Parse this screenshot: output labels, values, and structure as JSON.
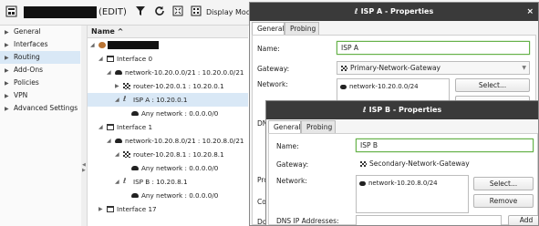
{
  "toolbar": {
    "edit_label": "(EDIT)",
    "display_label": "Display Mode"
  },
  "sidebar": {
    "items": [
      {
        "label": "General",
        "active": false
      },
      {
        "label": "Interfaces",
        "active": false
      },
      {
        "label": "Routing",
        "active": true
      },
      {
        "label": "Add-Ons",
        "active": false
      },
      {
        "label": "Policies",
        "active": false
      },
      {
        "label": "VPN",
        "active": false
      },
      {
        "label": "Advanced Settings",
        "active": false
      }
    ]
  },
  "tree": {
    "header": "Name ^",
    "rows": [
      {
        "label": "",
        "icon": "firewall-icon",
        "indent": 0
      },
      {
        "label": "Interface 0",
        "icon": "interface-icon",
        "indent": 1
      },
      {
        "label": "network-10.20.0.0/21 : 10.20.0.0/21",
        "icon": "network-icon",
        "indent": 2
      },
      {
        "label": "router-10.20.0.1 : 10.20.0.1",
        "icon": "router-icon",
        "indent": 3
      },
      {
        "label": "ISP A : 10.20.0.1",
        "icon": "isp-icon",
        "indent": 3,
        "selected": true
      },
      {
        "label": "Any network : 0.0.0.0/0",
        "icon": "network-icon",
        "indent": 4
      },
      {
        "label": "Interface 1",
        "icon": "interface-icon",
        "indent": 1
      },
      {
        "label": "network-10.20.8.0/21 : 10.20.8.0/21",
        "icon": "network-icon",
        "indent": 2
      },
      {
        "label": "router-10.20.8.1 : 10.20.8.1",
        "icon": "router-icon",
        "indent": 3
      },
      {
        "label": "Any network : 0.0.0.0/0",
        "icon": "network-icon",
        "indent": 4
      },
      {
        "label": "ISP B : 10.20.8.1",
        "icon": "isp-icon",
        "indent": 3
      },
      {
        "label": "Any network : 0.0.0.0/0",
        "icon": "network-icon",
        "indent": 4
      },
      {
        "label": "Interface 17",
        "icon": "interface-icon",
        "indent": 1
      }
    ]
  },
  "dialog_a": {
    "title": "ISP A - Properties",
    "close": "×",
    "tabs": [
      "General",
      "Probing"
    ],
    "name_label": "Name:",
    "name_value": "ISP A",
    "gateway_label": "Gateway:",
    "gateway_value": "Primary-Network-Gateway",
    "network_label": "Network:",
    "network_item": "network-10.20.0.0/24",
    "select_button": "Select...",
    "partial_labels": [
      "DNS",
      "Pro",
      "Con",
      "Dov"
    ]
  },
  "dialog_b": {
    "title": "ISP B - Properties",
    "tabs": [
      "General",
      "Probing"
    ],
    "name_label": "Name:",
    "name_value": "ISP B",
    "gateway_label": "Gateway:",
    "gateway_value": "Secondary-Network-Gateway",
    "network_label": "Network:",
    "network_item": "network-10.20.8.0/24",
    "select_button": "Select...",
    "remove_button": "Remove",
    "dns_label": "DNS IP Addresses:",
    "add_button": "Add"
  }
}
